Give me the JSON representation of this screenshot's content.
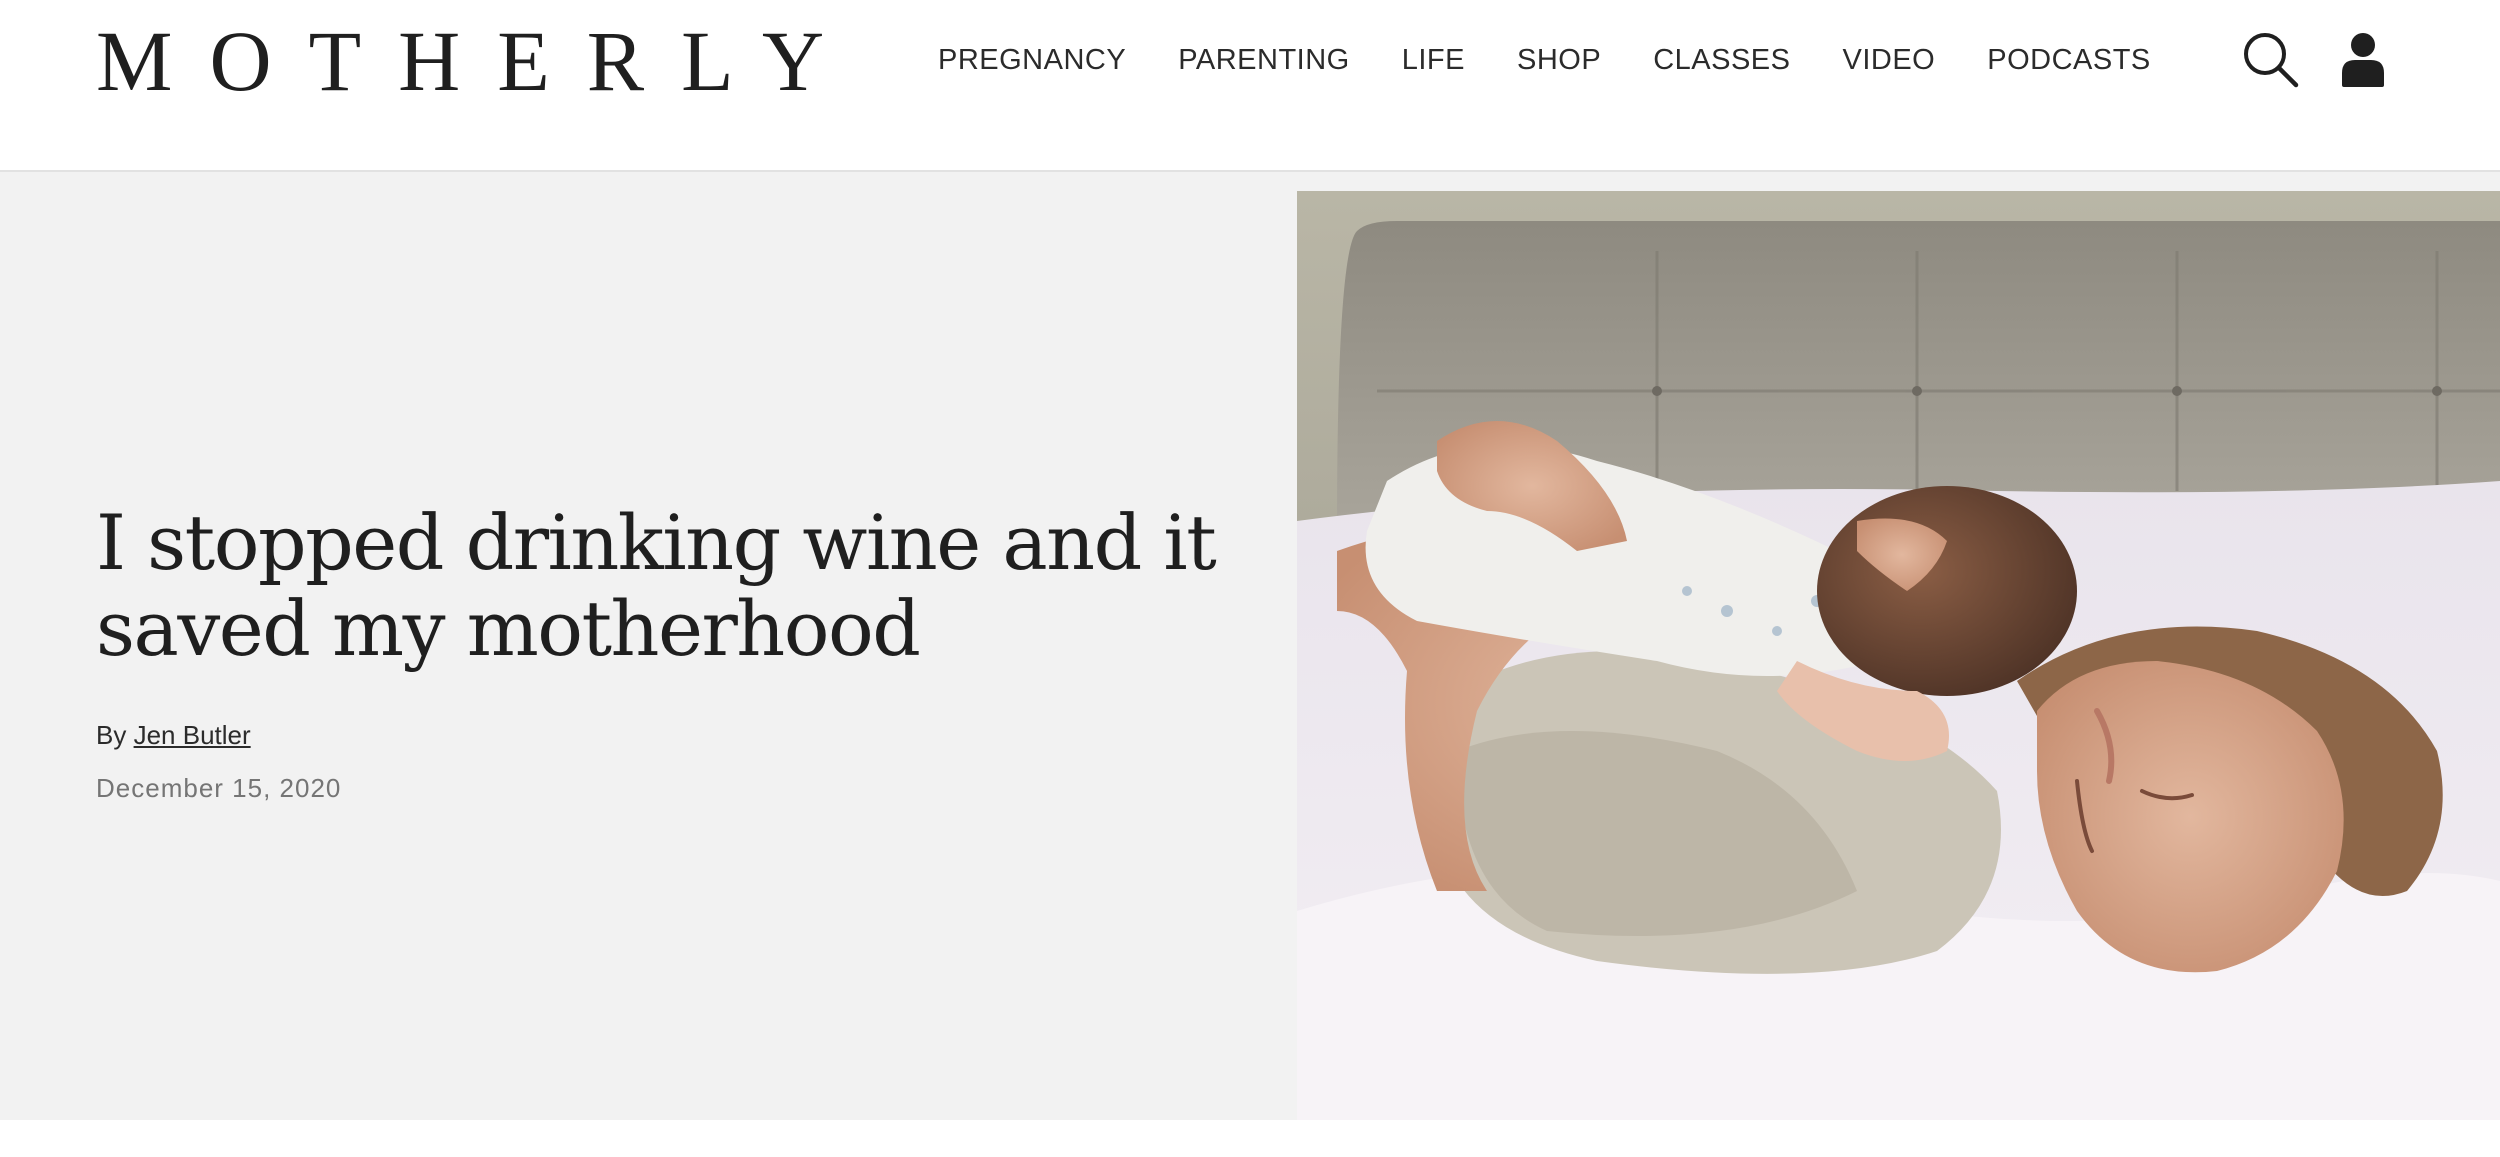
{
  "header": {
    "logo_text": "MOTHERLY",
    "nav": [
      {
        "label": "PREGNANCY"
      },
      {
        "label": "PARENTING"
      },
      {
        "label": "LIFE"
      },
      {
        "label": "SHOP"
      },
      {
        "label": "CLASSES"
      },
      {
        "label": "VIDEO"
      },
      {
        "label": "PODCASTS"
      }
    ],
    "icons": {
      "search": "search-icon",
      "account": "user-icon"
    }
  },
  "article": {
    "headline": "I stopped drinking wine and it saved my motherhood",
    "byline_prefix": "By",
    "author": "Jen Butler",
    "date": "December 15, 2020"
  },
  "colors": {
    "hero_background": "#f2f2f2",
    "text_dark": "#1f1f1f",
    "text_muted": "#757575"
  }
}
